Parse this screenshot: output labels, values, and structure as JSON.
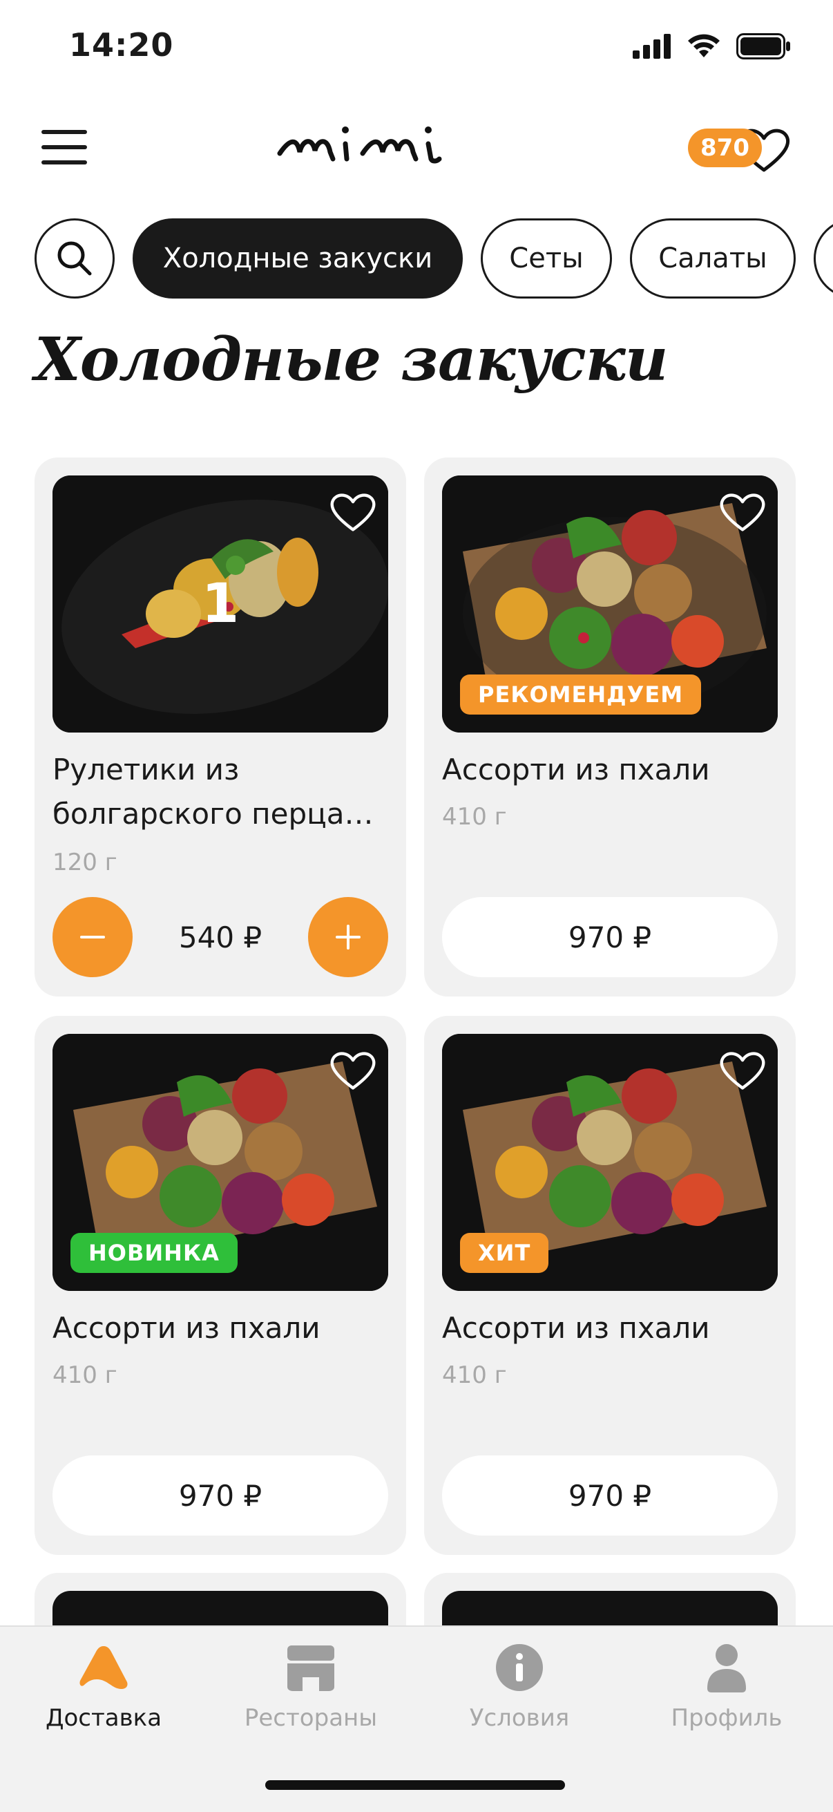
{
  "status_bar": {
    "time": "14:20"
  },
  "header": {
    "logo_text": "mimi",
    "bonus_points": "870"
  },
  "categories": [
    "Холодные закуски",
    "Сеты",
    "Салаты"
  ],
  "section_title": "Холодные закуски",
  "products": [
    {
      "name": "Рулетики из болгарского перца…",
      "weight": "120 г",
      "price": "540 ₽",
      "quantity": "1",
      "badge": ""
    },
    {
      "name": "Ассорти из пхали",
      "weight": "410 г",
      "price": "970 ₽",
      "badge": "РЕКОМЕНДУЕМ"
    },
    {
      "name": "Ассорти из пхали",
      "weight": "410 г",
      "price": "970 ₽",
      "badge": "НОВИНКА"
    },
    {
      "name": "Ассорти из пхали",
      "weight": "410 г",
      "price": "970 ₽",
      "badge": "ХИТ"
    }
  ],
  "badge_colors": {
    "recommend": "#f4952a",
    "new": "#2fbf3a",
    "hit": "#f4952a"
  },
  "accent_color": "#f4952a",
  "bottom_nav": [
    {
      "label": "Доставка",
      "icon": "delivery-icon",
      "active": true
    },
    {
      "label": "Рестораны",
      "icon": "restaurant-icon",
      "active": false
    },
    {
      "label": "Условия",
      "icon": "info-icon",
      "active": false
    },
    {
      "label": "Профиль",
      "icon": "profile-icon",
      "active": false
    }
  ]
}
